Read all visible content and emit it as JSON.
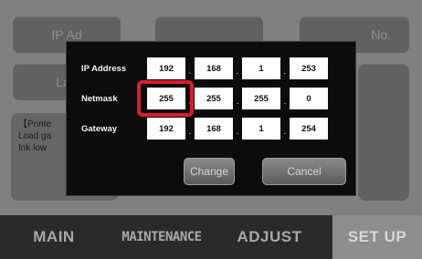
{
  "background": {
    "buttons": [
      {
        "label": "IP Ad"
      },
      {
        "label": ""
      },
      {
        "label": "No."
      },
      {
        "label": "Lan"
      }
    ],
    "info_lines": [
      "【Printe",
      "Load ga",
      "Ink low"
    ]
  },
  "dialog": {
    "rows": [
      {
        "label": "IP Address",
        "octets": [
          "192",
          "168",
          "1",
          "253"
        ]
      },
      {
        "label": "Netmask",
        "octets": [
          "255",
          "255",
          "255",
          "0"
        ]
      },
      {
        "label": "Gateway",
        "octets": [
          "192",
          "168",
          "1",
          "254"
        ]
      }
    ],
    "change_label": "Change",
    "cancel_label": "Cancel"
  },
  "bottom_nav": {
    "main": "MAIN",
    "maintenance": "MAINTENANCE",
    "adjust": "ADJUST",
    "setup": "SET UP"
  },
  "colors": {
    "highlight": "#d6202a",
    "active_tab": "#8e8e90"
  }
}
